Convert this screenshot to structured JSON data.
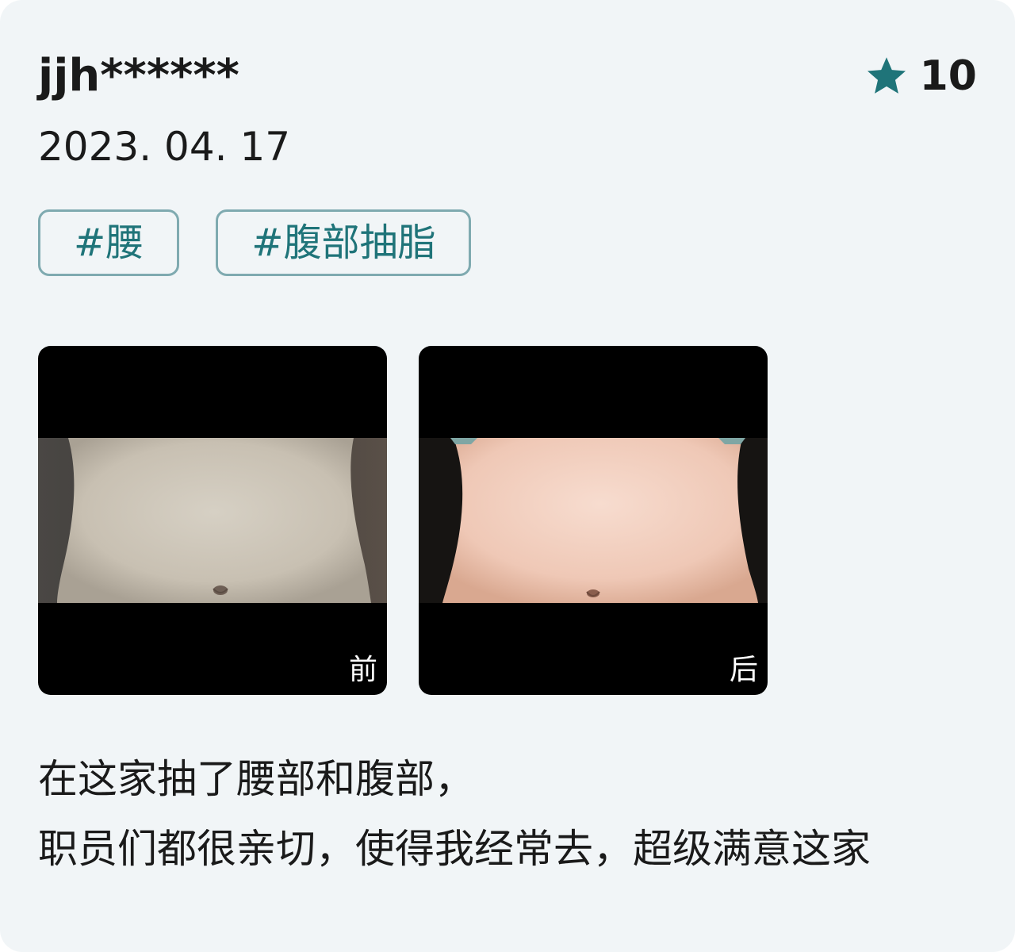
{
  "review": {
    "username": "jjh******",
    "rating": "10",
    "date": "2023. 04. 17",
    "tags": [
      "#腰",
      "#腹部抽脂"
    ],
    "photos": [
      {
        "label": "前"
      },
      {
        "label": "后"
      }
    ],
    "text_lines": [
      "在这家抽了腰部和腹部，",
      "职员们都很亲切，使得我经常去，超级满意这家"
    ]
  },
  "colors": {
    "accent": "#1f7479",
    "tag_border": "#7faab0",
    "card_bg": "#f1f5f7"
  },
  "icons": {
    "rating": "star-icon"
  }
}
